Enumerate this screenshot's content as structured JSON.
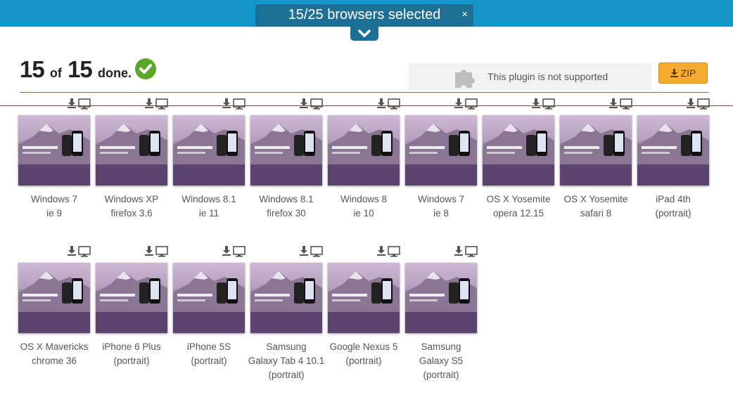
{
  "selection_bar": {
    "text": "15/25 browsers selected",
    "close": "×"
  },
  "status": {
    "done_count": "15",
    "of_word": "of",
    "total": "15",
    "done_word": "done."
  },
  "plugin": {
    "message": "This plugin is not supported"
  },
  "zip_button": {
    "label": "ZIP"
  },
  "colors": {
    "topbar": "#1595c9",
    "pill": "#1d6f93",
    "zip": "#f6ac2e",
    "check": "#5aa829"
  },
  "screenshots": [
    {
      "line1": "Windows 7",
      "line2": "ie 9",
      "line3": ""
    },
    {
      "line1": "Windows XP",
      "line2": "firefox 3.6",
      "line3": ""
    },
    {
      "line1": "Windows 8.1",
      "line2": "ie 11",
      "line3": ""
    },
    {
      "line1": "Windows 8.1",
      "line2": "firefox 30",
      "line3": ""
    },
    {
      "line1": "Windows 8",
      "line2": "ie 10",
      "line3": ""
    },
    {
      "line1": "Windows 7",
      "line2": "ie 8",
      "line3": ""
    },
    {
      "line1": "OS X Yosemite",
      "line2": "opera 12.15",
      "line3": ""
    },
    {
      "line1": "OS X Yosemite",
      "line2": "safari 8",
      "line3": ""
    },
    {
      "line1": "iPad 4th",
      "line2": "(portrait)",
      "line3": ""
    },
    {
      "line1": "OS X Mavericks",
      "line2": "chrome 36",
      "line3": ""
    },
    {
      "line1": "iPhone 6 Plus",
      "line2": "(portrait)",
      "line3": ""
    },
    {
      "line1": "iPhone 5S",
      "line2": "(portrait)",
      "line3": ""
    },
    {
      "line1": "Samsung",
      "line2": "Galaxy Tab 4 10.1",
      "line3": "(portrait)"
    },
    {
      "line1": "Google Nexus 5",
      "line2": "(portrait)",
      "line3": ""
    },
    {
      "line1": "Samsung",
      "line2": "Galaxy S5",
      "line3": "(portrait)"
    }
  ]
}
